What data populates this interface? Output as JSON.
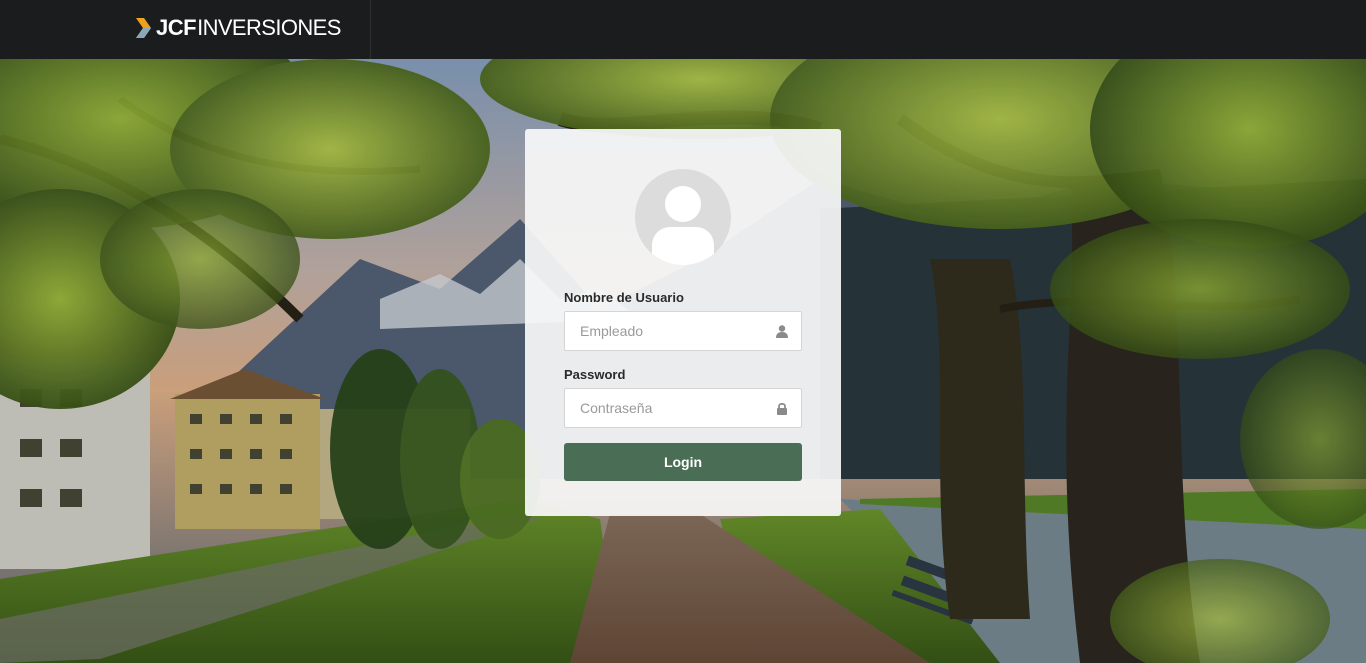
{
  "brand": {
    "logo_mark": "jcf-chevron-logo",
    "name_bold": "JCF",
    "name_light": "INVERSIONES",
    "accent_color": "#f0a01e"
  },
  "login": {
    "avatar_icon": "user-avatar-icon",
    "username_label": "Nombre de Usuario",
    "username_placeholder": "Empleado",
    "username_value": "",
    "username_icon": "user-icon",
    "password_label": "Password",
    "password_placeholder": "Contraseña",
    "password_value": "",
    "password_icon": "lock-icon",
    "submit_label": "Login",
    "button_color": "#4a6d56"
  }
}
